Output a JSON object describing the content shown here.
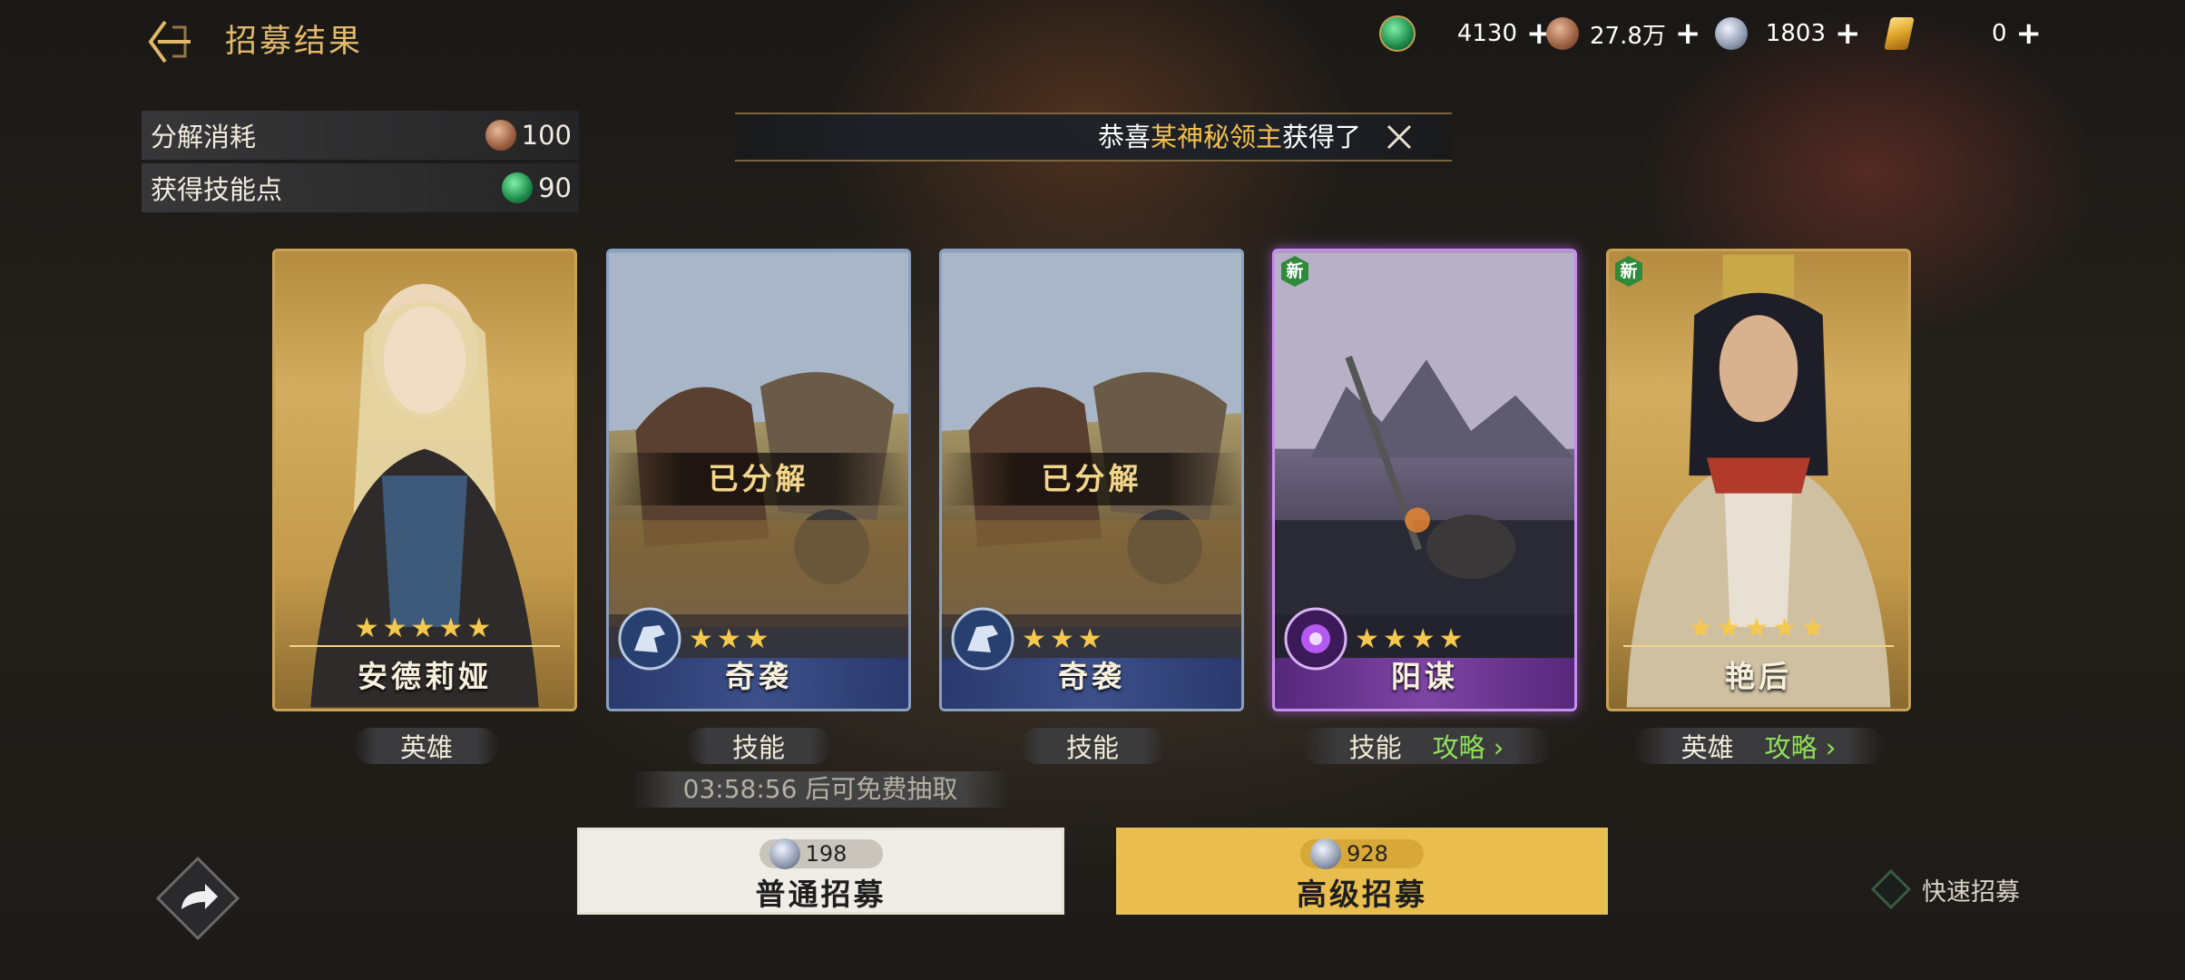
{
  "header": {
    "title": "招募结果",
    "back_icon": "back-arrow-icon",
    "resources": [
      {
        "name": "skill-gem",
        "value": "4130",
        "color": "#2aa35a"
      },
      {
        "name": "copper-coin",
        "value": "27.8万",
        "color": "#a06a4a"
      },
      {
        "name": "silver-coin",
        "value": "1803",
        "color": "#9aa4b8"
      },
      {
        "name": "gold-crystal",
        "value": "0",
        "color": "#e0a52a"
      }
    ]
  },
  "info": {
    "decompose_label": "分解消耗",
    "decompose_value": "100",
    "skill_points_label": "获得技能点",
    "skill_points_value": "90"
  },
  "broadcast": {
    "prefix": "恭喜",
    "player": "某神秘领主",
    "suffix": "获得了"
  },
  "cards": [
    {
      "type": "hero",
      "name": "安德莉娅",
      "stars": "★★★★★",
      "tag": "英雄",
      "guide": ""
    },
    {
      "type": "skill",
      "name": "奇袭",
      "stars": "★★★",
      "status": "已分解",
      "tag": "技能",
      "guide": ""
    },
    {
      "type": "skill",
      "name": "奇袭",
      "stars": "★★★",
      "status": "已分解",
      "tag": "技能",
      "guide": ""
    },
    {
      "type": "skill",
      "name": "阳谋",
      "stars": "★★★★",
      "badge": "新",
      "tag": "技能",
      "guide": "攻略 ›"
    },
    {
      "type": "hero",
      "name": "艳后",
      "stars": "★★★★★",
      "badge": "新",
      "tag": "英雄",
      "guide": "攻略 ›"
    }
  ],
  "timer": "03:58:56 后可免费抽取",
  "recruit": {
    "normal_label": "普通招募",
    "normal_cost": "198",
    "advanced_label": "高级招募",
    "advanced_cost": "928",
    "quick_label": "快速招募"
  },
  "colors": {
    "accent_gold": "#e2b86a",
    "guide_green": "#8fe05a",
    "star_gold": "#f6c94c"
  }
}
